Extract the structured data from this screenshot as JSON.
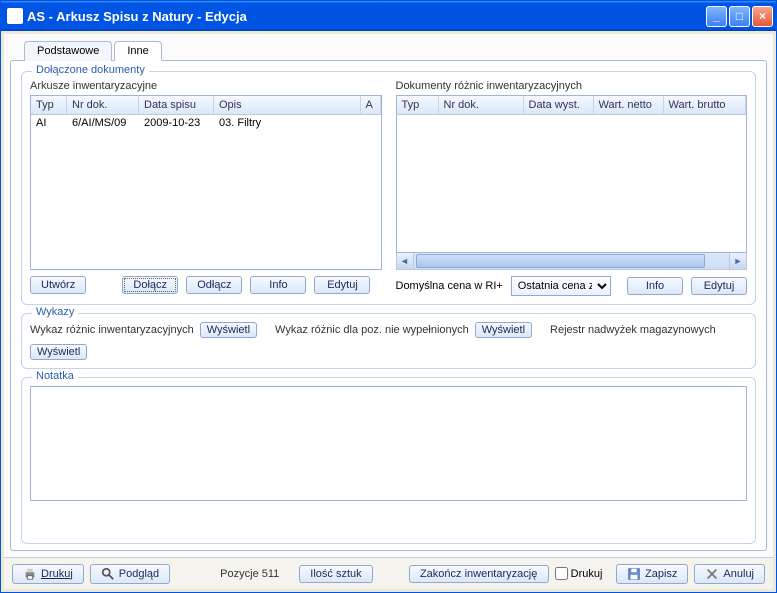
{
  "window": {
    "title": "AS - Arkusz Spisu z Natury - Edycja"
  },
  "tabs": {
    "t0": "Podstawowe",
    "t1": "Inne"
  },
  "sections": {
    "docs": {
      "title": "Dołączone dokumenty",
      "left_label": "Arkusze inwentaryzacyjne",
      "right_label": "Dokumenty różnic inwentaryzacyjnych",
      "left_cols": {
        "c0": "Typ",
        "c1": "Nr dok.",
        "c2": "Data spisu",
        "c3": "Opis",
        "c4": "A"
      },
      "right_cols": {
        "c0": "Typ",
        "c1": "Nr dok.",
        "c2": "Data wyst.",
        "c3": "Wart. netto",
        "c4": "Wart. brutto"
      },
      "left_rows": [
        {
          "typ": "AI",
          "nr": "6/AI/MS/09",
          "data": "2009-10-23",
          "opis": "03. Filtry",
          "a": ""
        }
      ],
      "buttons": {
        "utworz": "Utwórz",
        "dolacz": "Dołącz",
        "odlacz": "Odłącz",
        "info": "Info",
        "edytuj": "Edytuj"
      },
      "price_label": "Domyślna cena w RI+",
      "price_value": "Ostatnia cena z"
    },
    "wykazy": {
      "title": "Wykazy",
      "l1": "Wykaz różnic inwentaryzacyjnych",
      "l2": "Wykaz różnic dla poz. nie wypełnionych",
      "l3": "Rejestr nadwyżek magazynowych",
      "btn": "Wyświetl"
    },
    "notatka": {
      "title": "Notatka"
    }
  },
  "bottom": {
    "drukuj": "Drukuj",
    "podglad": "Podgląd",
    "pozycje": "Pozycje  511",
    "ilosc": "Ilość sztuk",
    "zakoncz": "Zakończ inwentaryzację",
    "chk_drukuj": "Drukuj",
    "zapisz": "Zapisz",
    "anuluj": "Anuluj"
  }
}
